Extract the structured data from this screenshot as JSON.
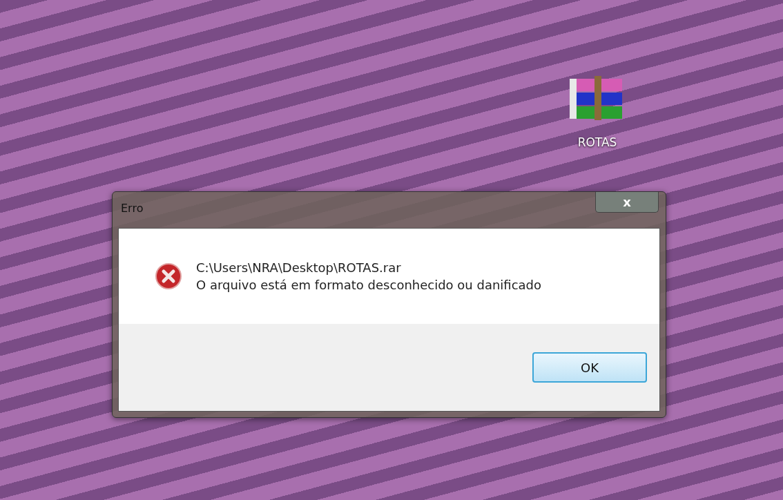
{
  "desktop_icons": [
    {
      "label": "ROTAS"
    }
  ],
  "dialog": {
    "title": "Erro",
    "close": "x",
    "path": "C:\\Users\\NRA\\Desktop\\ROTAS.rar",
    "message": "O arquivo está em formato desconhecido ou danificado",
    "buttons": [
      "OK"
    ]
  }
}
